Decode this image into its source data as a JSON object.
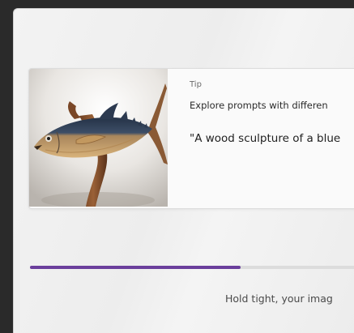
{
  "tip": {
    "kicker": "Tip",
    "heading": "Explore prompts with differen",
    "prompt": "\"A wood sculpture of a blue",
    "image_icon": "wooden-tuna-sculpture-image"
  },
  "progress": {
    "fraction": 0.62,
    "color": "#6b3f9c"
  },
  "status": {
    "text": "Hold tight, your imag"
  }
}
